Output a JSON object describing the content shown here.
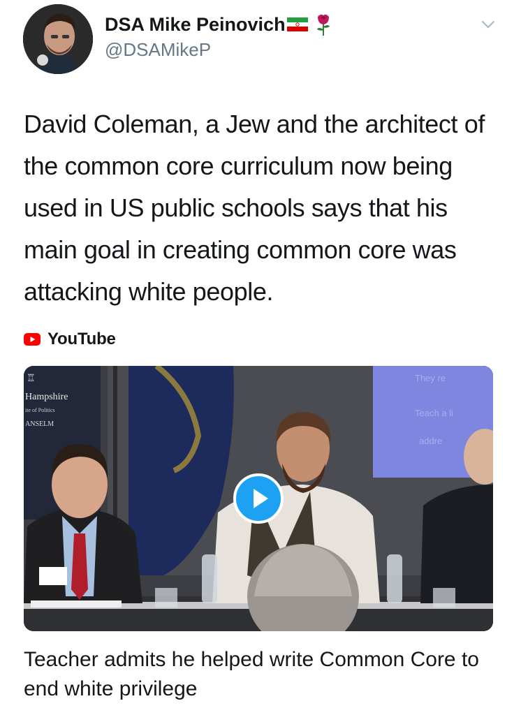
{
  "author": {
    "display_name": "DSA Mike Peinovich",
    "handle": "@DSAMikeP",
    "badges": [
      "iran-flag-icon",
      "rose-icon"
    ]
  },
  "tweet": {
    "text": "David Coleman, a Jew and the architect of the common core curriculum now being used in US public schools says that his main goal in creating common core was attacking white people."
  },
  "card": {
    "source": "YouTube",
    "source_icon": "youtube-icon",
    "video_sign_text": "Hampshire",
    "video_sign_subtext": "ite of Politics",
    "video_sign_name": "ANSELM",
    "screen_text": [
      "They re",
      "Teach a li",
      "addre"
    ],
    "play_icon": "play-icon",
    "title": "Teacher admits he helped write Common Core to end white privilege"
  },
  "menu_icon": "chevron-down-icon",
  "colors": {
    "accent": "#1da1f2",
    "text": "#14171a",
    "secondary": "#657786",
    "youtube_red": "#ff0000"
  }
}
